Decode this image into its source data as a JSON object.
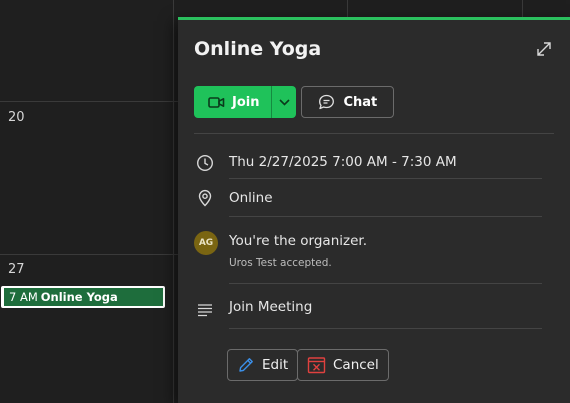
{
  "calendar": {
    "day_numbers": [
      "20",
      "27"
    ],
    "event": {
      "time": "7 AM",
      "title": "Online Yoga"
    }
  },
  "popup": {
    "title": "Online Yoga",
    "join_label": "Join",
    "chat_label": "Chat",
    "datetime": "Thu 2/27/2025 7:00 AM - 7:30 AM",
    "location": "Online",
    "avatar_initials": "AG",
    "organizer_text": "You're the organizer.",
    "attendee_status": "Uros Test accepted.",
    "meeting_link_label": "Join Meeting",
    "edit_label": "Edit",
    "cancel_label": "Cancel"
  },
  "icons": {
    "expand": "expand-icon",
    "join": "video-camera-icon",
    "join_dropdown": "chevron-down-icon",
    "chat": "chat-bubble-icon",
    "time": "clock-icon",
    "location": "location-pin-icon",
    "description": "text-lines-icon",
    "edit": "pencil-icon",
    "cancel": "cancel-calendar-icon"
  },
  "colors": {
    "accent_green": "#1fc25a",
    "event_green": "#1e6d3c",
    "popup_background": "#2b2b2b",
    "calendar_background": "#1f1f1f",
    "avatar_background": "#7a6512",
    "cancel_icon_red": "#e0413f",
    "edit_icon_blue": "#3b8fe8"
  }
}
